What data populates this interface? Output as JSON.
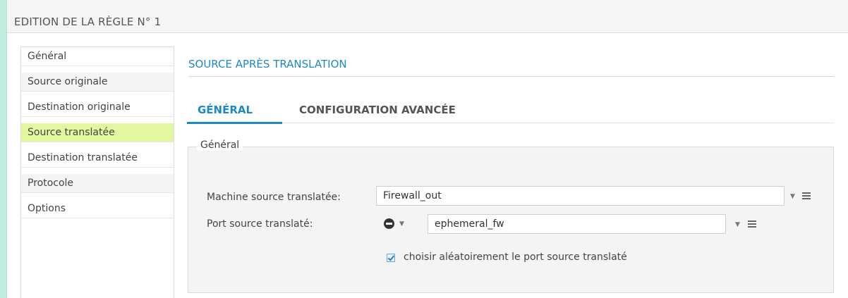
{
  "dialog": {
    "title": "EDITION DE LA RÈGLE N° 1"
  },
  "sidebar": {
    "items": [
      {
        "label": "Général"
      },
      {
        "label": "Source originale"
      },
      {
        "label": "Destination originale"
      },
      {
        "label": "Source translatée"
      },
      {
        "label": "Destination translatée"
      },
      {
        "label": "Protocole"
      },
      {
        "label": "Options"
      }
    ],
    "active_index": 3
  },
  "section": {
    "title": "SOURCE APRÈS TRANSLATION"
  },
  "tabs": [
    {
      "label": "GÉNÉRAL"
    },
    {
      "label": "CONFIGURATION AVANCÉE"
    }
  ],
  "panel": {
    "legend": "Général",
    "machine_label": "Machine source translatée:",
    "machine_value": "Firewall_out",
    "port_label": "Port source translaté:",
    "port_value": "ephemeral_fw",
    "random_port_label": "choisir aléatoirement le port source translaté",
    "random_port_checked": true
  },
  "icons": {
    "dropdown": "caret-down-icon",
    "object_list": "list-icon",
    "operator": "minus-circle-icon"
  },
  "colors": {
    "accent": "#1e88c6",
    "active_item_bg": "#e3f7a0",
    "page_bg": "#bfeedd"
  }
}
